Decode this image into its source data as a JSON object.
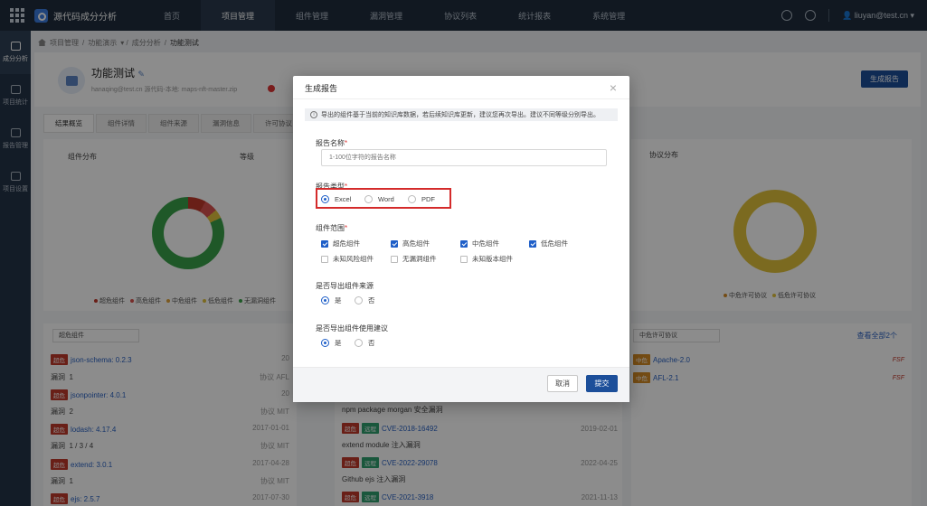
{
  "app": {
    "name": "源代码成分分析"
  },
  "nav": [
    "首页",
    "项目管理",
    "组件管理",
    "漏洞管理",
    "协议列表",
    "统计报表",
    "系统管理"
  ],
  "nav_active_index": 1,
  "user": {
    "email": "liuyan@test.cn"
  },
  "sidebar": [
    {
      "label": "成分分析",
      "active": true
    },
    {
      "label": "项目统计",
      "active": false
    },
    {
      "label": "报告管理",
      "active": false
    },
    {
      "label": "项目设置",
      "active": false
    }
  ],
  "breadcrumb": [
    "项目管理",
    "功能演示",
    "成分分析",
    "功能测试"
  ],
  "project": {
    "title": "功能测试",
    "subtitle": "hanaqing@test.cn 源代码-本地: maps-nft-master.zip"
  },
  "generate_button": "生成报告",
  "tabs": [
    "结果概览",
    "组件详情",
    "组件来源",
    "漏洞信息",
    "许可协议"
  ],
  "panels": {
    "component_dist": "组件分布",
    "level": "等级",
    "license_dist": "协议分布"
  },
  "component_legend": [
    "超危组件",
    "高危组件",
    "中危组件",
    "低危组件",
    "无漏洞组件"
  ],
  "license_legend": [
    "中危许可协议",
    "低危许可协议"
  ],
  "filter_left": "超危组件",
  "filter_right": "中危许可协议",
  "view_all": "查看全部2个",
  "left_rows": [
    {
      "tag": "超危",
      "name": "json-schema: 0.2.3",
      "right": "20"
    },
    {
      "label": "漏洞",
      "value": "1",
      "proto": "协议",
      "proto_val": "AFL"
    },
    {
      "tag": "超危",
      "name": "jsonpointer: 4.0.1",
      "right": "20"
    },
    {
      "label": "漏洞",
      "value": "2",
      "proto": "协议",
      "proto_val": "MIT"
    },
    {
      "tag": "超危",
      "name": "lodash: 4.17.4",
      "right": "2017-01-01"
    },
    {
      "label": "漏洞",
      "value": "1 / 3 / 4",
      "proto": "协议",
      "proto_val": "MIT"
    },
    {
      "tag": "超危",
      "name": "extend: 3.0.1",
      "right": "2017-04-28"
    },
    {
      "label": "漏洞",
      "value": "1",
      "proto": "协议",
      "proto_val": "MIT"
    },
    {
      "tag": "超危",
      "name": "ejs: 2.5.7",
      "right": "2017-07-30"
    }
  ],
  "mid_rows": [
    {
      "text": "npm package morgan 安全漏洞"
    },
    {
      "tag1": "超危",
      "tag2": "远程",
      "cve": "CVE-2018-16492",
      "date": "2019-02-01"
    },
    {
      "text": "extend module 注入漏洞"
    },
    {
      "tag1": "超危",
      "tag2": "远程",
      "cve": "CVE-2022-29078",
      "date": "2022-04-25"
    },
    {
      "text": "Github ejs 注入漏洞"
    },
    {
      "tag1": "超危",
      "tag2": "远程",
      "cve": "CVE-2021-3918",
      "date": "2021-11-13"
    }
  ],
  "right_rows": [
    {
      "tag": "中危",
      "name": "Apache-2.0",
      "badge": "FSF"
    },
    {
      "tag": "中危",
      "name": "AFL-2.1",
      "badge": "FSF"
    }
  ],
  "modal": {
    "title": "生成报告",
    "notice": "导出的组件基于当前的知识库数据，若后续知识库更新，建议您再次导出。建议不同等级分别导出。",
    "name_label": "报告名称",
    "name_placeholder": "1-100位字符的报告名称",
    "type_label": "报告类型",
    "types": [
      {
        "label": "Excel",
        "checked": true
      },
      {
        "label": "Word",
        "checked": false
      },
      {
        "label": "PDF",
        "checked": false
      }
    ],
    "scope_label": "组件范围",
    "scope_items": [
      {
        "label": "超危组件",
        "checked": true
      },
      {
        "label": "高危组件",
        "checked": true
      },
      {
        "label": "中危组件",
        "checked": true
      },
      {
        "label": "低危组件",
        "checked": true
      },
      {
        "label": "未知风险组件",
        "checked": false
      },
      {
        "label": "无漏洞组件",
        "checked": false
      },
      {
        "label": "未知版本组件",
        "checked": false
      }
    ],
    "source_label": "是否导出组件来源",
    "source_options": [
      {
        "label": "是",
        "checked": true
      },
      {
        "label": "否",
        "checked": false
      }
    ],
    "advice_label": "是否导出组件使用建议",
    "advice_options": [
      {
        "label": "是",
        "checked": true
      },
      {
        "label": "否",
        "checked": false
      }
    ],
    "cancel": "取消",
    "submit": "提交"
  },
  "colors": {
    "topbar": "#1f2d3d",
    "sidebar": "#243447",
    "primary": "#1c4f9a",
    "critical": "#c0392b",
    "highlight": "#d42b2b",
    "donut_green": "#3aa14a",
    "donut_yellow": "#e1c23b"
  }
}
